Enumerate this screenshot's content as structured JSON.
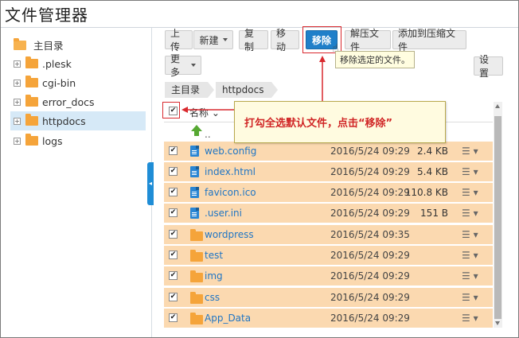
{
  "app": {
    "title": "文件管理器"
  },
  "sidebar": {
    "root_label": "主目录",
    "items": [
      {
        "label": ".plesk"
      },
      {
        "label": "cgi-bin"
      },
      {
        "label": "error_docs"
      },
      {
        "label": "httpdocs",
        "selected": true
      },
      {
        "label": "logs"
      }
    ]
  },
  "toolbar": {
    "upload": "上传",
    "new": "新建",
    "copy": "复制",
    "move": "移动",
    "remove": "移除",
    "extract": "解压文件",
    "add_to_archive": "添加到压缩文件",
    "more": "更多",
    "settings": "设置"
  },
  "tooltip": {
    "remove": "移除选定的文件。"
  },
  "breadcrumb": [
    "主目录",
    "httpdocs"
  ],
  "table": {
    "name_header": "名称",
    "parent_label": "..",
    "rows": [
      {
        "name": "web.config",
        "date": "2016/5/24 09:29",
        "size": "2.4 KB",
        "type": "file",
        "icon": "config-file-icon"
      },
      {
        "name": "index.html",
        "date": "2016/5/24 09:29",
        "size": "5.4 KB",
        "type": "file",
        "icon": "html-file-icon"
      },
      {
        "name": "favicon.ico",
        "date": "2016/5/24 09:29",
        "size": "110.8 KB",
        "type": "file",
        "icon": "binary-file-icon"
      },
      {
        "name": ".user.ini",
        "date": "2016/5/24 09:29",
        "size": "151 B",
        "type": "file",
        "icon": "text-file-icon"
      },
      {
        "name": "wordpress",
        "date": "2016/5/24 09:35",
        "size": "",
        "type": "folder",
        "icon": "folder-icon"
      },
      {
        "name": "test",
        "date": "2016/5/24 09:29",
        "size": "",
        "type": "folder",
        "icon": "folder-icon"
      },
      {
        "name": "img",
        "date": "2016/5/24 09:29",
        "size": "",
        "type": "folder",
        "icon": "folder-icon"
      },
      {
        "name": "css",
        "date": "2016/5/24 09:29",
        "size": "",
        "type": "folder",
        "icon": "folder-icon"
      },
      {
        "name": "App_Data",
        "date": "2016/5/24 09:29",
        "size": "",
        "type": "folder",
        "icon": "folder-icon"
      }
    ]
  },
  "annotation": {
    "text": "打勾全选默认文件，点击“移除”"
  },
  "colors": {
    "accent": "#1f7fc9",
    "row_highlight": "#fbd9b0",
    "annotation_red": "#d9292e"
  }
}
